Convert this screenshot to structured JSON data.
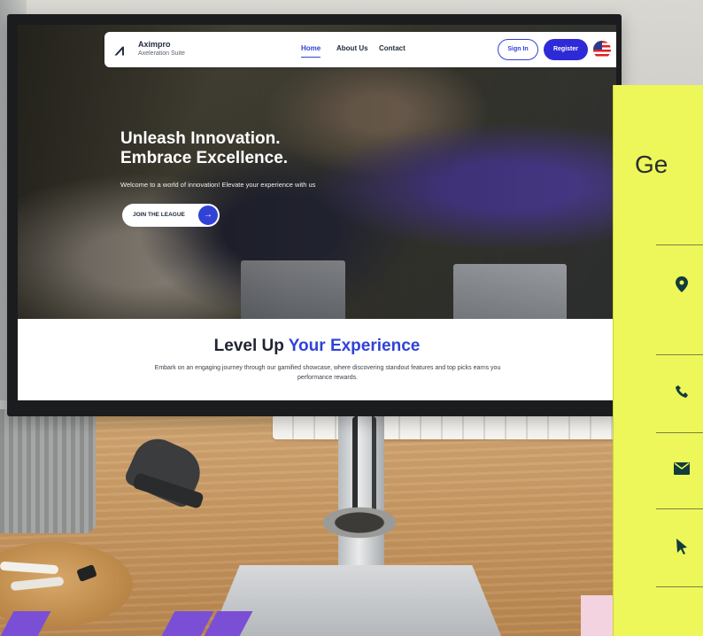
{
  "site": {
    "logo_name": "Aximpro",
    "logo_tagline": "Axeleration Suite",
    "nav": {
      "home": "Home",
      "about": "About Us",
      "contact": "Contact"
    },
    "sign_in": "Sign In",
    "register": "Register",
    "language_flag": "us-flag-icon",
    "hero": {
      "title_line1": "Unleash Innovation.",
      "title_line2": "Embrace Excellence.",
      "subtitle": "Welcome to a world of innovation! Elevate your experience with us",
      "cta": "JOIN THE LEAGUE"
    },
    "section": {
      "title_part1": "Level Up",
      "title_part2": "Your Experience",
      "body": "Embark on an engaging journey through our gamified showcase, where discovering standout features and top picks earns you performance rewards."
    }
  },
  "card": {
    "title": "Ge",
    "icons": [
      "map-pin-icon",
      "phone-icon",
      "mail-icon",
      "cursor-icon"
    ]
  },
  "colors": {
    "brand_blue": "#3043d6",
    "card_yellow": "#edf75a",
    "accent_purple": "#7a4fd6"
  }
}
